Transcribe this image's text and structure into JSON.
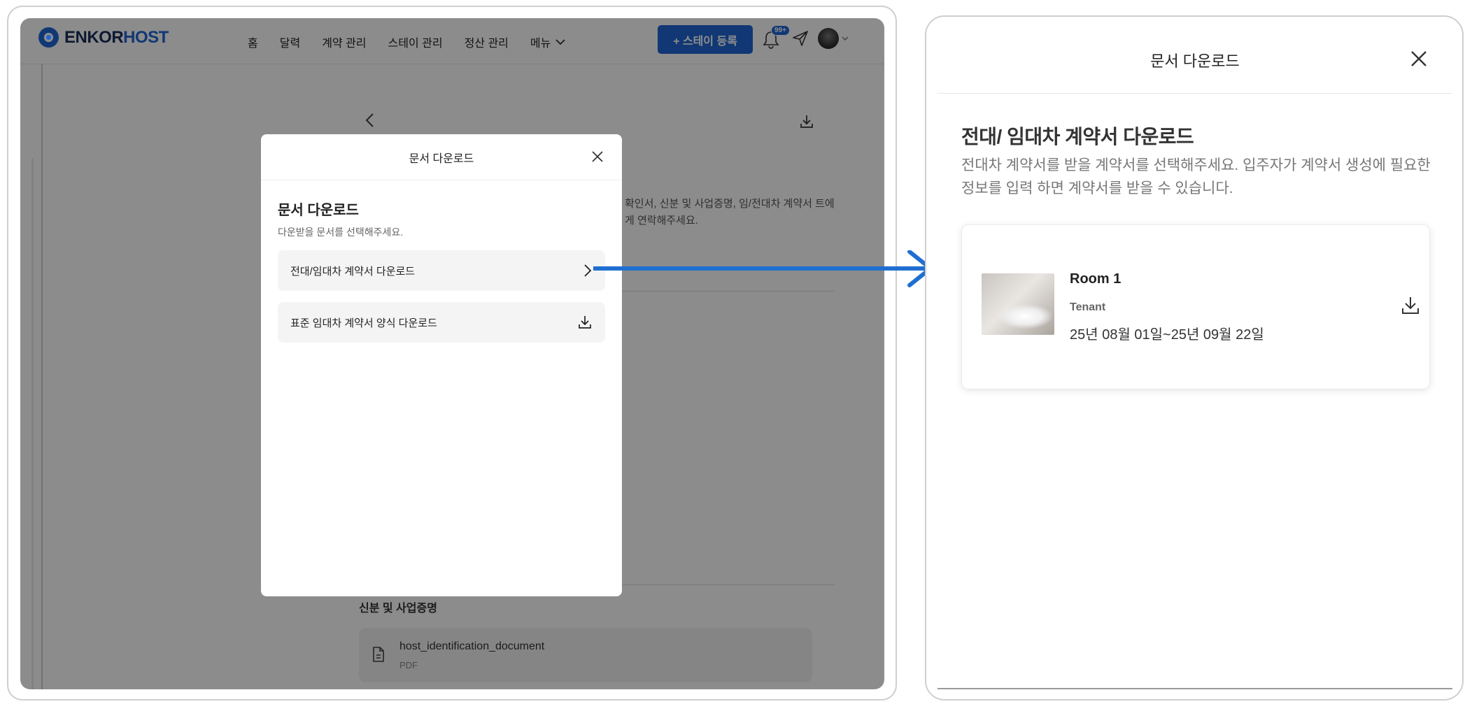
{
  "left": {
    "logo": {
      "part1": "ENKOR",
      "part2": "HOST"
    },
    "nav": [
      "홈",
      "달력",
      "계약 관리",
      "스테이 관리",
      "정산 관리"
    ],
    "nav_menu": "메뉴",
    "register_button": "+ 스테이 등록",
    "notification_badge": "99+",
    "background": {
      "notice_text": "확인서, 신분 및 사업증명, 임/전대차 계약서 트에게 연락해주세요.",
      "section_title": "신분 및 사업증명",
      "file_name": "host_identification_document",
      "file_type": "PDF"
    },
    "modal": {
      "title": "문서 다운로드",
      "heading": "문서 다운로드",
      "subtitle": "다운받을 문서를 선택해주세요.",
      "options": [
        {
          "label": "전대/임대차 계약서 다운로드",
          "icon": "chevron-right-icon"
        },
        {
          "label": "표준 임대차 계약서 양식 다운로드",
          "icon": "download-icon"
        }
      ]
    }
  },
  "right": {
    "title": "문서 다운로드",
    "heading": "전대/ 임대차 계약서 다운로드",
    "description": "전대차 계약서를 받을 계약서를 선택해주세요. 입주자가 계약서 생성에 필요한 정보를 입력 하면 계약서를 받을 수 있습니다.",
    "room": {
      "name": "Room 1",
      "role": "Tenant",
      "dates": "25년 08월 01일~25년 09월 22일"
    }
  },
  "colors": {
    "brand": "#1f66d6",
    "overlay": "rgba(0,0,0,0.45)",
    "arrow": "#1f6fd1"
  }
}
